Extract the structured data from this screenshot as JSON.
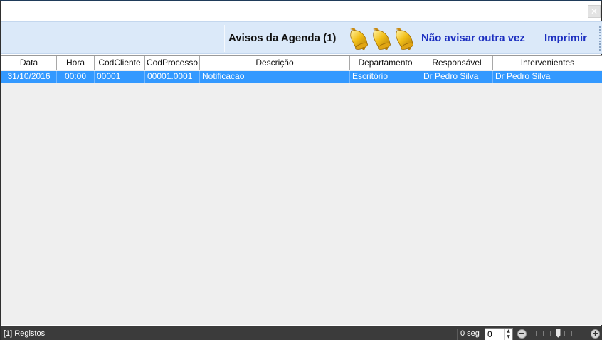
{
  "window": {
    "close_glyph": "✕"
  },
  "toolbar": {
    "title": "Avisos da Agenda (1)",
    "bells_icon": "bell-icon",
    "no_warn_label": "Não avisar outra vez",
    "print_label": "Imprimir"
  },
  "grid": {
    "columns": [
      "Data",
      "Hora",
      "CodCliente",
      "CodProcesso",
      "Descrição",
      "Departamento",
      "Responsável",
      "Intervenientes"
    ],
    "rows": [
      {
        "data": "31/10/2016",
        "hora": "00:00",
        "cod_cliente": "00001",
        "cod_processo": "00001.0001",
        "descricao": "Notificacao",
        "departamento": "Escritório",
        "responsavel": "Dr Pedro Silva",
        "intervenientes": "Dr Pedro Silva"
      }
    ],
    "selected_row_color": "#3399ff"
  },
  "statusbar": {
    "records_label": "[1] Registos",
    "seconds_label": "0 seg",
    "spinner_value": "0",
    "zoom_minus": "−",
    "zoom_plus": "+"
  },
  "colors": {
    "toolbar_bg": "#dbe9f9",
    "link_color": "#1c2fc0",
    "statusbar_bg": "#3b3b3b"
  }
}
